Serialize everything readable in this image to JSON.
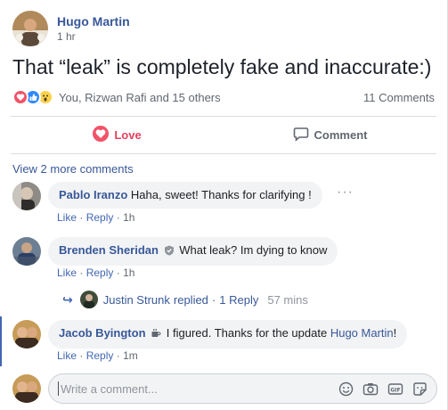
{
  "post": {
    "author": "Hugo Martin",
    "time": "1 hr",
    "text": "That “leak” is completely fake and inaccurate:)",
    "reaction_icons": [
      "love-icon",
      "like-icon",
      "wow-icon"
    ],
    "reaction_summary": "You, Rizwan Rafi and 15 others",
    "comment_count": "11 Comments"
  },
  "actions": {
    "love": "Love",
    "comment": "Comment"
  },
  "comments": {
    "view_more": "View 2 more comments",
    "items": [
      {
        "name": "Pablo Iranzo",
        "text": "Haha, sweet! Thanks for clarifying !",
        "like": "Like",
        "sep": "·",
        "reply": "Reply",
        "time": "1h"
      },
      {
        "name": "Brenden Sheridan",
        "text": "What leak? Im dying to know",
        "like": "Like",
        "sep": "·",
        "reply": "Reply",
        "time": "1h",
        "badge_icon": "shield-badge-icon"
      },
      {
        "name": "Jacob Byington",
        "text": "I figured. Thanks for the update",
        "mention": "Hugo Martin",
        "end": "!",
        "like": "Like",
        "sep": "·",
        "reply": "Reply",
        "time": "1m",
        "badge_icon": "coffee-badge-icon"
      }
    ],
    "replies": {
      "name": "Justin Strunk",
      "text": "replied",
      "sep": "·",
      "count": "1 Reply",
      "time": "57 mins"
    }
  },
  "composer": {
    "placeholder": "Write a comment...",
    "icons": [
      "emoji-icon",
      "camera-icon",
      "gif-icon",
      "sticker-icon"
    ]
  },
  "colors": {
    "link": "#385898",
    "love": "#e4405f",
    "like": "#4267b2",
    "bubble": "#f2f3f5"
  }
}
